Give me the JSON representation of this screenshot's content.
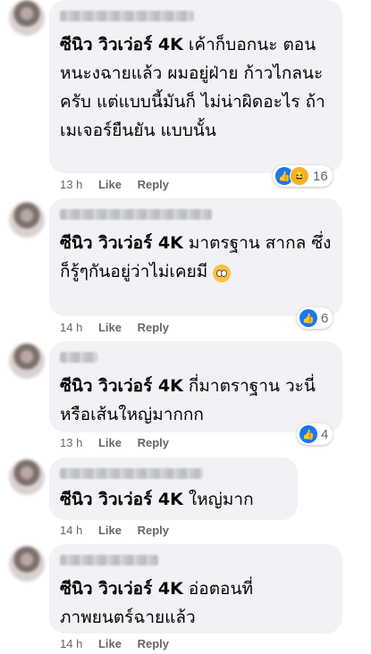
{
  "comments": [
    {
      "tag": "ซีนิว วิวเว่อร์ 4K",
      "text": " เค้าก็บอกนะ ตอนหนะงฉายแล้ว ผมอยู่ฝ่าย ก้าวไกลนะครับ แต่แบบนี้มันก็ ไม่น่าผิดอะไร ถ้าเมเจอร์ยืนยัน แบบนั้น",
      "time": "13 h",
      "like": "Like",
      "reply": "Reply",
      "reactions": [
        "like-icon",
        "haha-icon"
      ],
      "reaction_count": "16"
    },
    {
      "tag": "ซีนิว วิวเว่อร์ 4K",
      "text": " มาตรฐาน สากล ซึ่งก็รู้ๆกันอยู่ว่าไม่เคยมี",
      "emoji": "pleading-face-emoji",
      "time": "14 h",
      "like": "Like",
      "reply": "Reply",
      "reactions": [
        "like-icon"
      ],
      "reaction_count": "6"
    },
    {
      "tag": "ซีนิว วิวเว่อร์ 4K",
      "text": " กี่มาตราฐาน วะนี่หรือเส้นใหญ่มากกก",
      "time": "13 h",
      "like": "Like",
      "reply": "Reply",
      "reactions": [
        "like-icon"
      ],
      "reaction_count": "4"
    },
    {
      "tag": "ซีนิว วิวเว่อร์ 4K",
      "text": " ใหญ่มาก",
      "time": "14 h",
      "like": "Like",
      "reply": "Reply"
    },
    {
      "tag": "ซีนิว วิวเว่อร์ 4K",
      "text": " อ่อตอนที่ ภาพยนตร์ฉายแล้ว",
      "time": "14 h",
      "like": "Like",
      "reply": "Reply"
    }
  ]
}
